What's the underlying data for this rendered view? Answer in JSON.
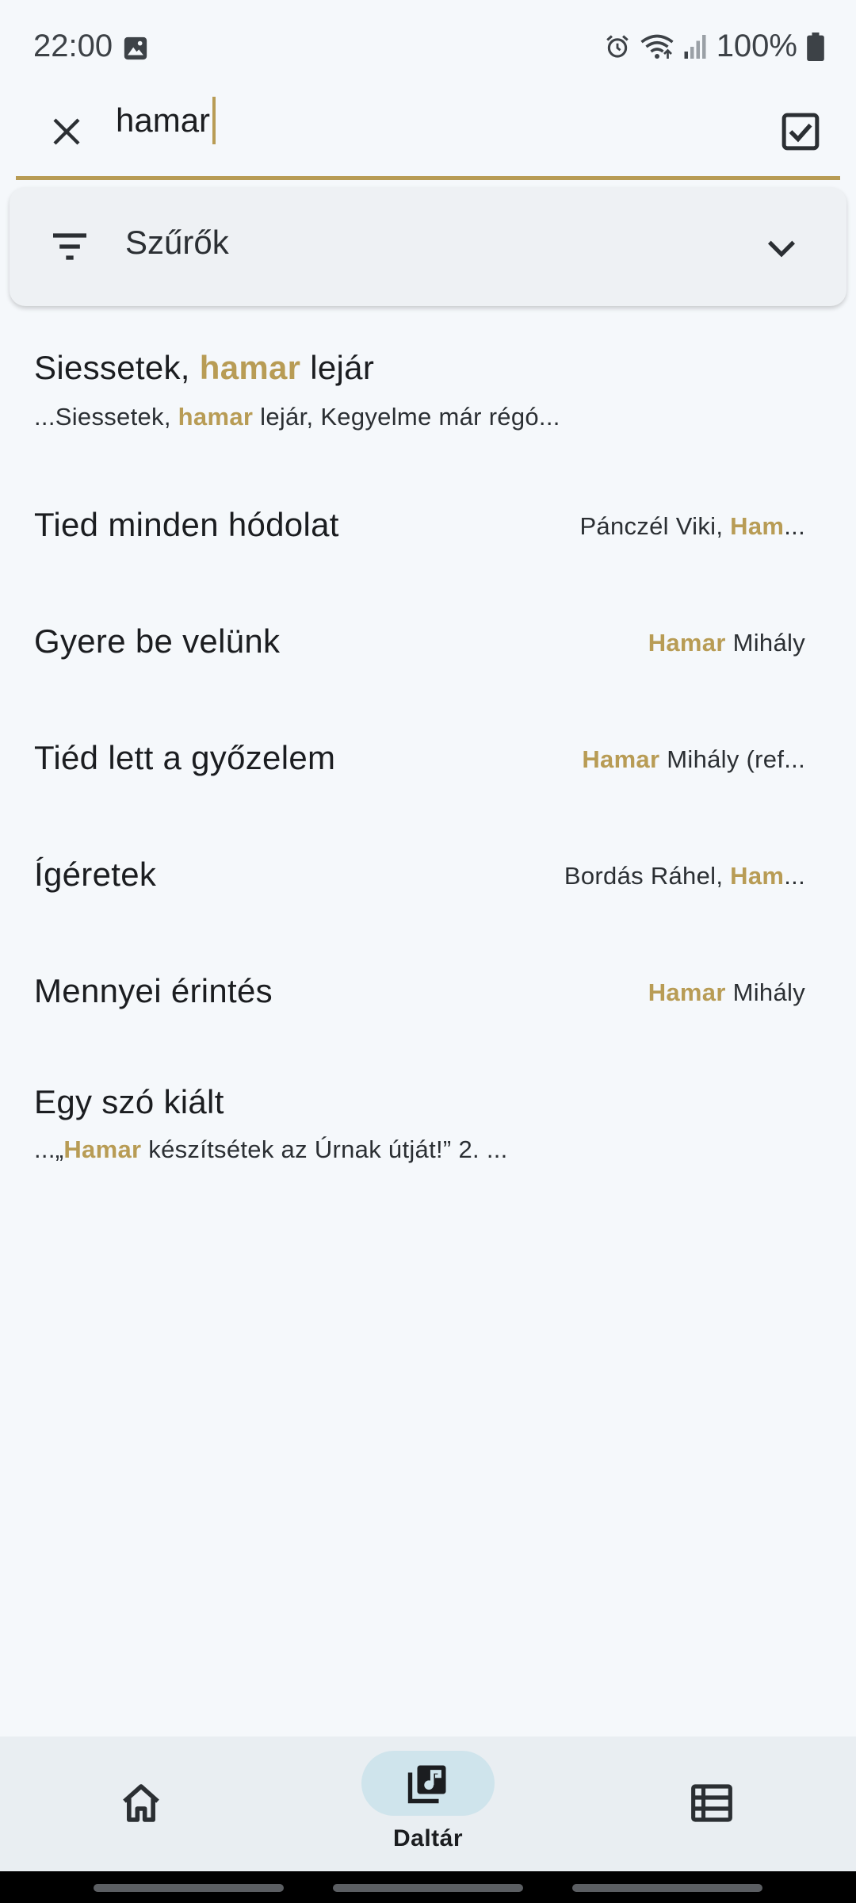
{
  "status": {
    "time": "22:00",
    "battery": "100%"
  },
  "search": {
    "query": "hamar"
  },
  "filters": {
    "label": "Szűrők"
  },
  "colors": {
    "accent": "#b89c55",
    "nav_pill": "#cfe4ec"
  },
  "results": [
    {
      "title_pre": "Siessetek, ",
      "title_hl": "hamar",
      "title_post": " lejár",
      "snippet_pre": "...Siessetek, ",
      "snippet_hl": "hamar",
      "snippet_post": " lejár,  Kegyelme már régó..."
    },
    {
      "title": "Tied minden hódolat",
      "author_pre": "Pánczél Viki, ",
      "author_hl": "Ham",
      "author_post": "..."
    },
    {
      "title": "Gyere be velünk",
      "author_pre": "",
      "author_hl": "Hamar",
      "author_post": " Mihály"
    },
    {
      "title": "Tiéd lett a győzelem",
      "author_pre": "",
      "author_hl": "Hamar",
      "author_post": " Mihály (ref..."
    },
    {
      "title": "Ígéretek",
      "author_pre": "Bordás Ráhel, ",
      "author_hl": "Ham",
      "author_post": "..."
    },
    {
      "title": "Mennyei érintés",
      "author_pre": "",
      "author_hl": "Hamar",
      "author_post": " Mihály"
    },
    {
      "title": "Egy szó kiált",
      "snippet_pre": "...„",
      "snippet_hl": "Hamar",
      "snippet_post": " készítsétek az Úrnak útját!”    2. ..."
    }
  ],
  "nav": {
    "home_icon": "home-icon",
    "library_label": "Daltár",
    "library_icon": "music-library-icon",
    "list_icon": "list-icon"
  }
}
